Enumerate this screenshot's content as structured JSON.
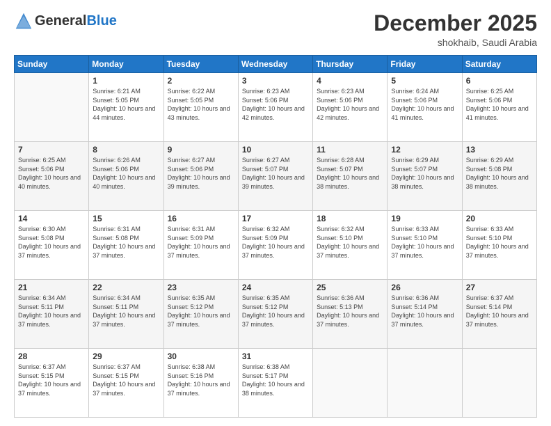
{
  "header": {
    "logo_general": "General",
    "logo_blue": "Blue",
    "month_title": "December 2025",
    "location": "shokhaib, Saudi Arabia"
  },
  "days_of_week": [
    "Sunday",
    "Monday",
    "Tuesday",
    "Wednesday",
    "Thursday",
    "Friday",
    "Saturday"
  ],
  "weeks": [
    [
      {
        "day": "",
        "sunrise": "",
        "sunset": "",
        "daylight": ""
      },
      {
        "day": "1",
        "sunrise": "Sunrise: 6:21 AM",
        "sunset": "Sunset: 5:05 PM",
        "daylight": "Daylight: 10 hours and 44 minutes."
      },
      {
        "day": "2",
        "sunrise": "Sunrise: 6:22 AM",
        "sunset": "Sunset: 5:05 PM",
        "daylight": "Daylight: 10 hours and 43 minutes."
      },
      {
        "day": "3",
        "sunrise": "Sunrise: 6:23 AM",
        "sunset": "Sunset: 5:06 PM",
        "daylight": "Daylight: 10 hours and 42 minutes."
      },
      {
        "day": "4",
        "sunrise": "Sunrise: 6:23 AM",
        "sunset": "Sunset: 5:06 PM",
        "daylight": "Daylight: 10 hours and 42 minutes."
      },
      {
        "day": "5",
        "sunrise": "Sunrise: 6:24 AM",
        "sunset": "Sunset: 5:06 PM",
        "daylight": "Daylight: 10 hours and 41 minutes."
      },
      {
        "day": "6",
        "sunrise": "Sunrise: 6:25 AM",
        "sunset": "Sunset: 5:06 PM",
        "daylight": "Daylight: 10 hours and 41 minutes."
      }
    ],
    [
      {
        "day": "7",
        "sunrise": "Sunrise: 6:25 AM",
        "sunset": "Sunset: 5:06 PM",
        "daylight": "Daylight: 10 hours and 40 minutes."
      },
      {
        "day": "8",
        "sunrise": "Sunrise: 6:26 AM",
        "sunset": "Sunset: 5:06 PM",
        "daylight": "Daylight: 10 hours and 40 minutes."
      },
      {
        "day": "9",
        "sunrise": "Sunrise: 6:27 AM",
        "sunset": "Sunset: 5:06 PM",
        "daylight": "Daylight: 10 hours and 39 minutes."
      },
      {
        "day": "10",
        "sunrise": "Sunrise: 6:27 AM",
        "sunset": "Sunset: 5:07 PM",
        "daylight": "Daylight: 10 hours and 39 minutes."
      },
      {
        "day": "11",
        "sunrise": "Sunrise: 6:28 AM",
        "sunset": "Sunset: 5:07 PM",
        "daylight": "Daylight: 10 hours and 38 minutes."
      },
      {
        "day": "12",
        "sunrise": "Sunrise: 6:29 AM",
        "sunset": "Sunset: 5:07 PM",
        "daylight": "Daylight: 10 hours and 38 minutes."
      },
      {
        "day": "13",
        "sunrise": "Sunrise: 6:29 AM",
        "sunset": "Sunset: 5:08 PM",
        "daylight": "Daylight: 10 hours and 38 minutes."
      }
    ],
    [
      {
        "day": "14",
        "sunrise": "Sunrise: 6:30 AM",
        "sunset": "Sunset: 5:08 PM",
        "daylight": "Daylight: 10 hours and 37 minutes."
      },
      {
        "day": "15",
        "sunrise": "Sunrise: 6:31 AM",
        "sunset": "Sunset: 5:08 PM",
        "daylight": "Daylight: 10 hours and 37 minutes."
      },
      {
        "day": "16",
        "sunrise": "Sunrise: 6:31 AM",
        "sunset": "Sunset: 5:09 PM",
        "daylight": "Daylight: 10 hours and 37 minutes."
      },
      {
        "day": "17",
        "sunrise": "Sunrise: 6:32 AM",
        "sunset": "Sunset: 5:09 PM",
        "daylight": "Daylight: 10 hours and 37 minutes."
      },
      {
        "day": "18",
        "sunrise": "Sunrise: 6:32 AM",
        "sunset": "Sunset: 5:10 PM",
        "daylight": "Daylight: 10 hours and 37 minutes."
      },
      {
        "day": "19",
        "sunrise": "Sunrise: 6:33 AM",
        "sunset": "Sunset: 5:10 PM",
        "daylight": "Daylight: 10 hours and 37 minutes."
      },
      {
        "day": "20",
        "sunrise": "Sunrise: 6:33 AM",
        "sunset": "Sunset: 5:10 PM",
        "daylight": "Daylight: 10 hours and 37 minutes."
      }
    ],
    [
      {
        "day": "21",
        "sunrise": "Sunrise: 6:34 AM",
        "sunset": "Sunset: 5:11 PM",
        "daylight": "Daylight: 10 hours and 37 minutes."
      },
      {
        "day": "22",
        "sunrise": "Sunrise: 6:34 AM",
        "sunset": "Sunset: 5:11 PM",
        "daylight": "Daylight: 10 hours and 37 minutes."
      },
      {
        "day": "23",
        "sunrise": "Sunrise: 6:35 AM",
        "sunset": "Sunset: 5:12 PM",
        "daylight": "Daylight: 10 hours and 37 minutes."
      },
      {
        "day": "24",
        "sunrise": "Sunrise: 6:35 AM",
        "sunset": "Sunset: 5:12 PM",
        "daylight": "Daylight: 10 hours and 37 minutes."
      },
      {
        "day": "25",
        "sunrise": "Sunrise: 6:36 AM",
        "sunset": "Sunset: 5:13 PM",
        "daylight": "Daylight: 10 hours and 37 minutes."
      },
      {
        "day": "26",
        "sunrise": "Sunrise: 6:36 AM",
        "sunset": "Sunset: 5:14 PM",
        "daylight": "Daylight: 10 hours and 37 minutes."
      },
      {
        "day": "27",
        "sunrise": "Sunrise: 6:37 AM",
        "sunset": "Sunset: 5:14 PM",
        "daylight": "Daylight: 10 hours and 37 minutes."
      }
    ],
    [
      {
        "day": "28",
        "sunrise": "Sunrise: 6:37 AM",
        "sunset": "Sunset: 5:15 PM",
        "daylight": "Daylight: 10 hours and 37 minutes."
      },
      {
        "day": "29",
        "sunrise": "Sunrise: 6:37 AM",
        "sunset": "Sunset: 5:15 PM",
        "daylight": "Daylight: 10 hours and 37 minutes."
      },
      {
        "day": "30",
        "sunrise": "Sunrise: 6:38 AM",
        "sunset": "Sunset: 5:16 PM",
        "daylight": "Daylight: 10 hours and 37 minutes."
      },
      {
        "day": "31",
        "sunrise": "Sunrise: 6:38 AM",
        "sunset": "Sunset: 5:17 PM",
        "daylight": "Daylight: 10 hours and 38 minutes."
      },
      {
        "day": "",
        "sunrise": "",
        "sunset": "",
        "daylight": ""
      },
      {
        "day": "",
        "sunrise": "",
        "sunset": "",
        "daylight": ""
      },
      {
        "day": "",
        "sunrise": "",
        "sunset": "",
        "daylight": ""
      }
    ]
  ]
}
